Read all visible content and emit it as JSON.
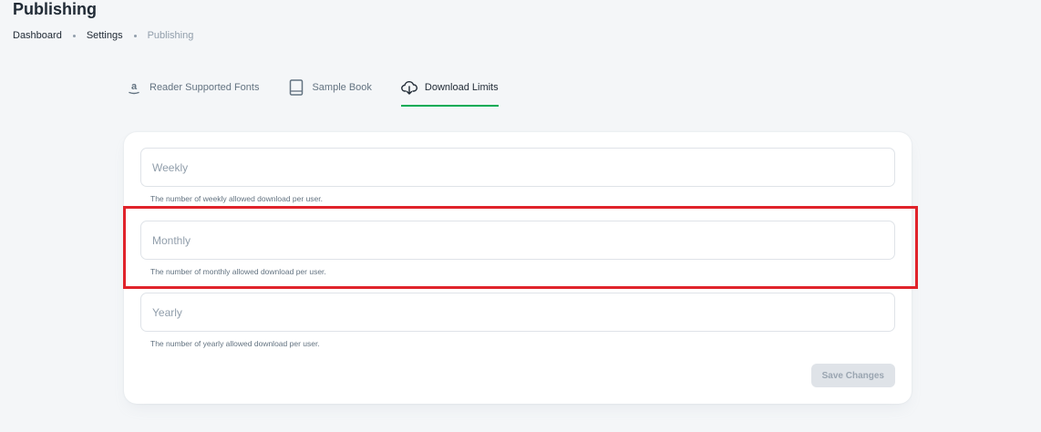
{
  "header": {
    "title": "Publishing"
  },
  "breadcrumb": {
    "items": [
      "Dashboard",
      "Settings",
      "Publishing"
    ]
  },
  "tabs": [
    {
      "label": "Reader Supported Fonts",
      "icon": "amazon-icon",
      "active": false
    },
    {
      "label": "Sample Book",
      "icon": "book-icon",
      "active": false
    },
    {
      "label": "Download Limits",
      "icon": "cloud-download-icon",
      "active": true
    }
  ],
  "form": {
    "fields": [
      {
        "placeholder": "Weekly",
        "value": "",
        "helper": "The number of weekly allowed download per user."
      },
      {
        "placeholder": "Monthly",
        "value": "",
        "helper": "The number of monthly allowed download per user."
      },
      {
        "placeholder": "Yearly",
        "value": "",
        "helper": "The number of yearly allowed download per user."
      }
    ],
    "save_label": "Save Changes"
  },
  "colors": {
    "accent": "#00ab55",
    "highlight": "#e0232b",
    "background": "#f4f6f8"
  }
}
